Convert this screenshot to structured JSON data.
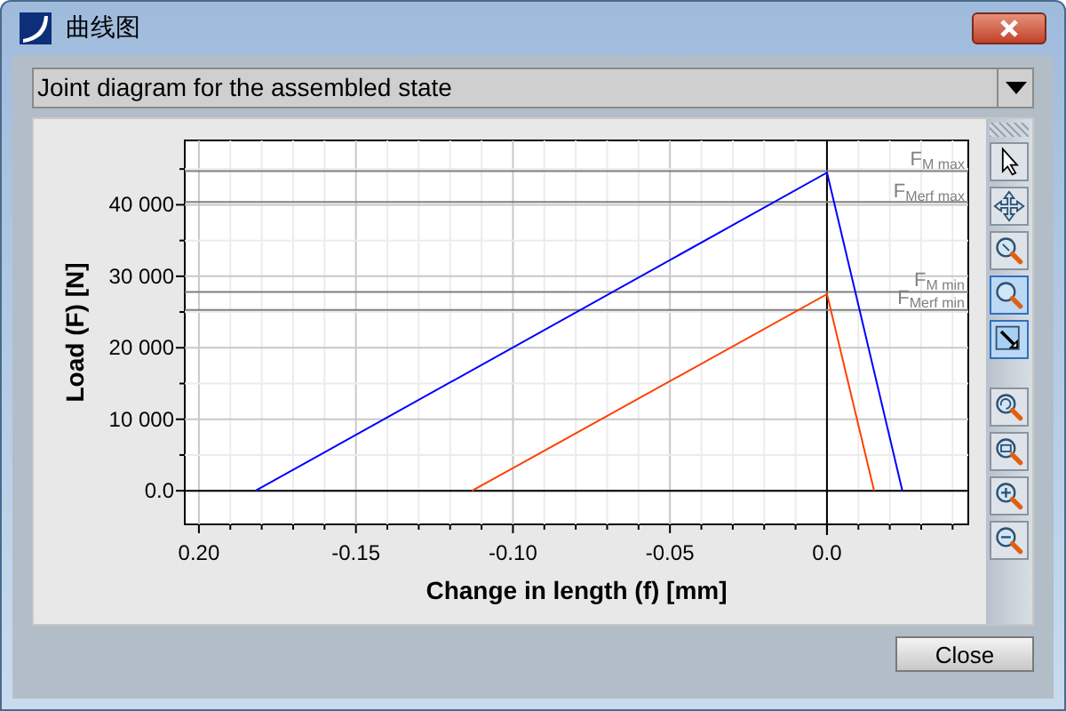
{
  "window": {
    "title": "曲线图"
  },
  "diagram_select": {
    "value": "Joint diagram for the assembled state"
  },
  "chart": {
    "chart_data": {
      "type": "line",
      "xlabel": "Change in length (f) [mm]",
      "ylabel": "Load (F) [N]",
      "xlim": [
        -0.2045,
        0.045
      ],
      "ylim": [
        -4700,
        49000
      ],
      "xticks": [
        {
          "value": -0.2,
          "label": "0.20"
        },
        {
          "value": -0.15,
          "label": "-0.15"
        },
        {
          "value": -0.1,
          "label": "-0.10"
        },
        {
          "value": -0.05,
          "label": "-0.05"
        },
        {
          "value": 0,
          "label": "0.0"
        }
      ],
      "yticks": [
        {
          "value": 0,
          "label": "0.0"
        },
        {
          "value": 10000,
          "label": "10 000"
        },
        {
          "value": 20000,
          "label": "20 000"
        },
        {
          "value": 30000,
          "label": "30 000"
        },
        {
          "value": 40000,
          "label": "40 000"
        }
      ],
      "series": [
        {
          "color": "#0000ff",
          "x": [
            -0.182,
            0,
            0.024
          ],
          "values": [
            0,
            44500,
            0
          ]
        },
        {
          "color": "#ff4000",
          "x": [
            -0.113,
            0,
            0.015
          ],
          "values": [
            0,
            27500,
            0
          ]
        }
      ],
      "grid": true,
      "ref_lines": [
        {
          "axis": "y",
          "value": 44700,
          "label": "F$_{M max}$"
        },
        {
          "axis": "y",
          "value": 40400,
          "label": "F$_{Merf max}$"
        },
        {
          "axis": "y",
          "value": 27800,
          "label": "F$_{M min}$"
        },
        {
          "axis": "y",
          "value": 25300,
          "label": "F$_{Merf min}$"
        }
      ]
    }
  },
  "tools": [
    {
      "kind": "pointer",
      "selected": false
    },
    {
      "kind": "pan",
      "selected": false
    },
    {
      "kind": "zoom-fit",
      "selected": false
    },
    {
      "kind": "zoom",
      "selected": true
    },
    {
      "kind": "zoom-box",
      "selected": true
    },
    {
      "kind": "zoom-reset",
      "selected": false
    },
    {
      "kind": "zoom-all",
      "selected": false
    },
    {
      "kind": "zoom-in",
      "selected": false
    },
    {
      "kind": "zoom-out",
      "selected": false
    }
  ],
  "buttons": [
    {
      "label": "Close"
    }
  ]
}
